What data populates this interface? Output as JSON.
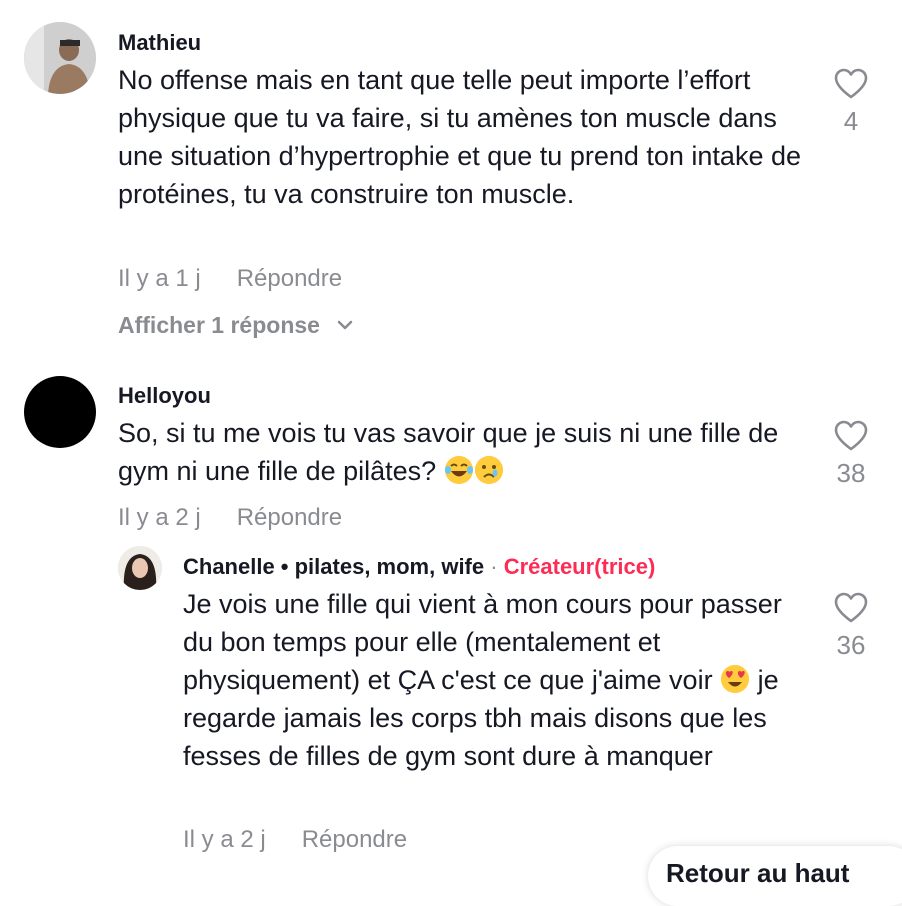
{
  "comments": [
    {
      "username": "Mathieu",
      "text": "No offense mais en tant que telle peut importe l’effort physique que tu va faire, si tu amènes ton muscle dans une situation d’hypertrophie et que tu prend ton intake de protéines, tu va construire ton muscle.",
      "time": "Il y a 1 j",
      "reply_label": "Répondre",
      "likes": "4",
      "view_replies": "Afficher 1 réponse"
    },
    {
      "username": "Helloyou",
      "text": "So, si tu me vois tu vas savoir que je suis ni une fille de gym ni une fille de pilâtes?",
      "time": "Il y a 2 j",
      "reply_label": "Répondre",
      "likes": "38"
    }
  ],
  "reply": {
    "username": "Chanelle • pilates, mom, wife",
    "separator": "·",
    "creator_badge": "Créateur(trice)",
    "text_part1": "Je vois une fille qui vient à mon cours pour passer du bon temps pour elle (mentalement et physiquement) et ÇA c'est ce que j'aime voir",
    "text_part2": "je regarde jamais les corps tbh mais disons que les fesses de filles de gym sont dure à manquer",
    "time": "Il y a 2 j",
    "reply_label": "Répondre",
    "likes": "36"
  },
  "bottom_pill": {
    "label": "Retour au haut"
  },
  "icons": {
    "like": "heart-outline-icon",
    "expand": "chevron-down-icon",
    "emoji_laugh": "tears-of-joy-emoji",
    "emoji_sad": "crying-face-emoji",
    "emoji_love": "heart-eyes-emoji"
  },
  "colors": {
    "creator": "#fe2c55",
    "muted": "#8a8b91",
    "text": "#161823"
  }
}
